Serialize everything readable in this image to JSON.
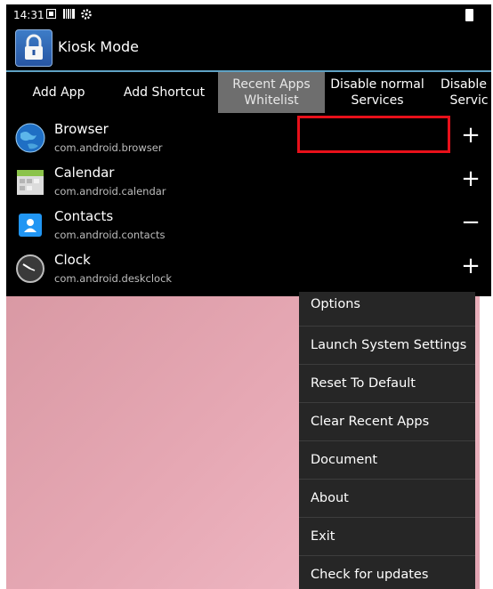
{
  "status_bar": {
    "time": "14:31"
  },
  "app_bar": {
    "title": "Kiosk Mode",
    "icon": "lock-icon",
    "accent": "#5fa2c4"
  },
  "tabs": [
    {
      "label": "Add App"
    },
    {
      "label": "Add Shortcut"
    },
    {
      "label": "Recent Apps\nWhitelist",
      "selected": true
    },
    {
      "label": "Disable normal\nServices"
    },
    {
      "label": "Disable c\nServic"
    }
  ],
  "apps": [
    {
      "name": "Browser",
      "package": "com.android.browser",
      "action": "+",
      "icon": "globe-icon"
    },
    {
      "name": "Calendar",
      "package": "com.android.calendar",
      "action": "+",
      "icon": "calendar-icon"
    },
    {
      "name": "Contacts",
      "package": "com.android.contacts",
      "action": "−",
      "icon": "contacts-icon"
    },
    {
      "name": "Clock",
      "package": "com.android.deskclock",
      "action": "+",
      "icon": "clock-icon"
    }
  ],
  "highlight_color": "#e8101a",
  "menu": {
    "items": [
      "Options",
      "Launch System Settings",
      "Reset To Default",
      "Clear Recent Apps",
      "Document",
      "About",
      "Exit",
      "Check for updates"
    ]
  }
}
